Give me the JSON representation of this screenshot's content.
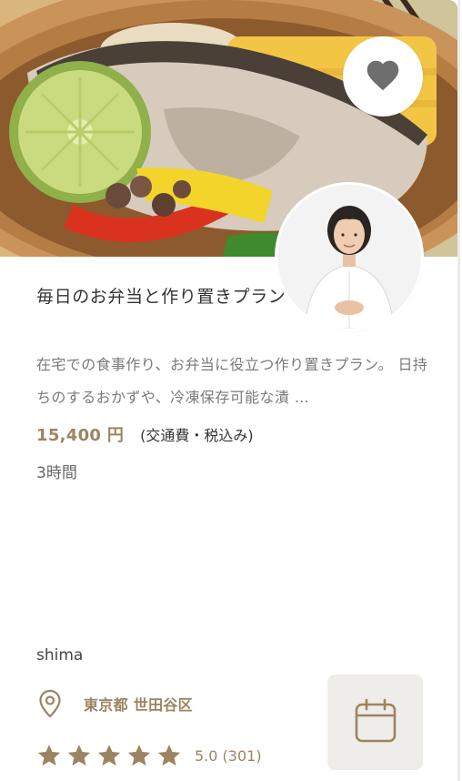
{
  "plan": {
    "title": "毎日のお弁当と作り置きプラン",
    "description": "在宅での食事作り、お弁当に役立つ作り置きプラン。 日持ちのするおかずや、冷凍保存可能な漬 …",
    "price": "15,400 円",
    "price_note": "(交通費・税込み)",
    "duration": "3時間"
  },
  "chef": {
    "name": "shima",
    "location": "東京都 世田谷区",
    "rating_value": 5.0,
    "rating_text": "5.0 (301)"
  },
  "icons": {
    "favorite": "heart-icon",
    "location": "map-pin-icon",
    "schedule": "calendar-icon",
    "rating": "star-icon"
  },
  "colors": {
    "accent": "#9c8462",
    "icon_gray": "#6e6e6e",
    "button_bg": "#efedea"
  }
}
